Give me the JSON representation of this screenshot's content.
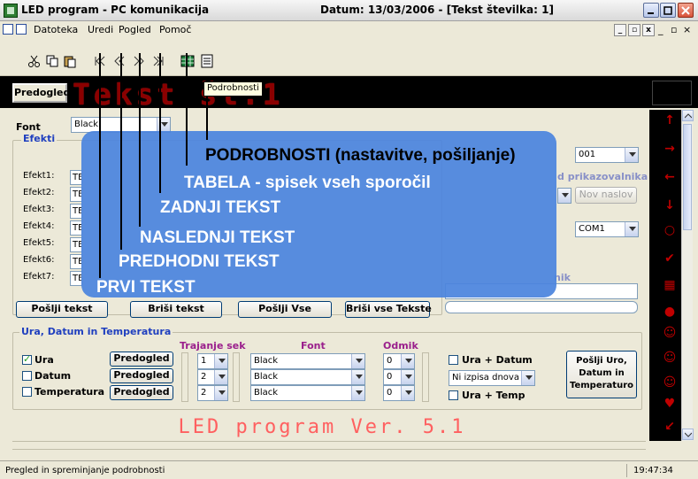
{
  "window": {
    "title": "LED program - PC komunikacija",
    "date_info": "Datum: 13/03/2006 - [Tekst številka:  1]"
  },
  "menu": {
    "items": [
      "Datoteka",
      "Uredi",
      "Pogled",
      "Pomoč"
    ]
  },
  "toolbar": {
    "tooltip": "Podrobnosti",
    "icons": [
      "cut-icon",
      "copy-icon",
      "paste-icon",
      "first-icon",
      "prev-icon",
      "next-icon",
      "last-icon",
      "table-icon",
      "details-icon"
    ]
  },
  "preview": {
    "button": "Predogled",
    "led_text": "Tekst št.1"
  },
  "font": {
    "label": "Font",
    "value": "Black"
  },
  "efekti": {
    "legend": "Efekti",
    "rows": [
      {
        "label": "Efekt1:",
        "value": "TE"
      },
      {
        "label": "Efekt2:",
        "value": "TE"
      },
      {
        "label": "Efekt3:",
        "value": "TE"
      },
      {
        "label": "Efekt4:",
        "value": "TE"
      },
      {
        "label": "Efekt5:",
        "value": "TE"
      },
      {
        "label": "Efekt6:",
        "value": "TE"
      },
      {
        "label": "Efekt7:",
        "value": "TE"
      }
    ]
  },
  "right_settings": {
    "number": "001",
    "display_label": "d prikazovalnika",
    "new_title_btn": "Nov naslov",
    "port": "COM1",
    "nik_label": "nik"
  },
  "action_buttons": {
    "send_text": "Pošlji tekst",
    "delete_text": "Briši tekst",
    "send_all": "Pošlji Vse",
    "delete_all": "Briši vse Tekste"
  },
  "annotations": {
    "details": "PODROBNOSTI (nastavitve, pošiljanje)",
    "table": "TABELA - spisek vseh sporočil",
    "last": "ZADNJI TEKST",
    "next": "NASLEDNJI TEKST",
    "prev": "PREDHODNI TEKST",
    "first": "PRVI TEKST"
  },
  "ura": {
    "legend": "Ura, Datum in Temperatura",
    "col_trajanje": "Trajanje sek",
    "col_font": "Font",
    "col_odmik": "Odmik",
    "rows": [
      {
        "label": "Ura",
        "checked": true,
        "preview": "Predogled",
        "seconds": "1",
        "font": "Black",
        "offset": "0"
      },
      {
        "label": "Datum",
        "checked": false,
        "preview": "Predogled",
        "seconds": "2",
        "font": "Black",
        "offset": "0"
      },
      {
        "label": "Temperatura",
        "checked": false,
        "preview": "Predogled",
        "seconds": "2",
        "font": "Black",
        "offset": "0"
      }
    ],
    "ura_datum": "Ura  +  Datum",
    "no_date": "Ni izpisa dnova",
    "ura_temp": "Ura  +  Temp",
    "send_button_l1": "Pošlji Uro,",
    "send_button_l2": "Datum in",
    "send_button_l3": "Temperaturo"
  },
  "banner": {
    "led_version": "LED program Ver. 5.1"
  },
  "status": {
    "text": "Pregled in spreminjanje podrobnosti",
    "time": "19:47:34"
  },
  "colors": {
    "overlay": "#4b84de",
    "led_red": "#c00000",
    "legend_blue": "#1f3fbf",
    "col_head_purple": "#9a1f8c"
  }
}
